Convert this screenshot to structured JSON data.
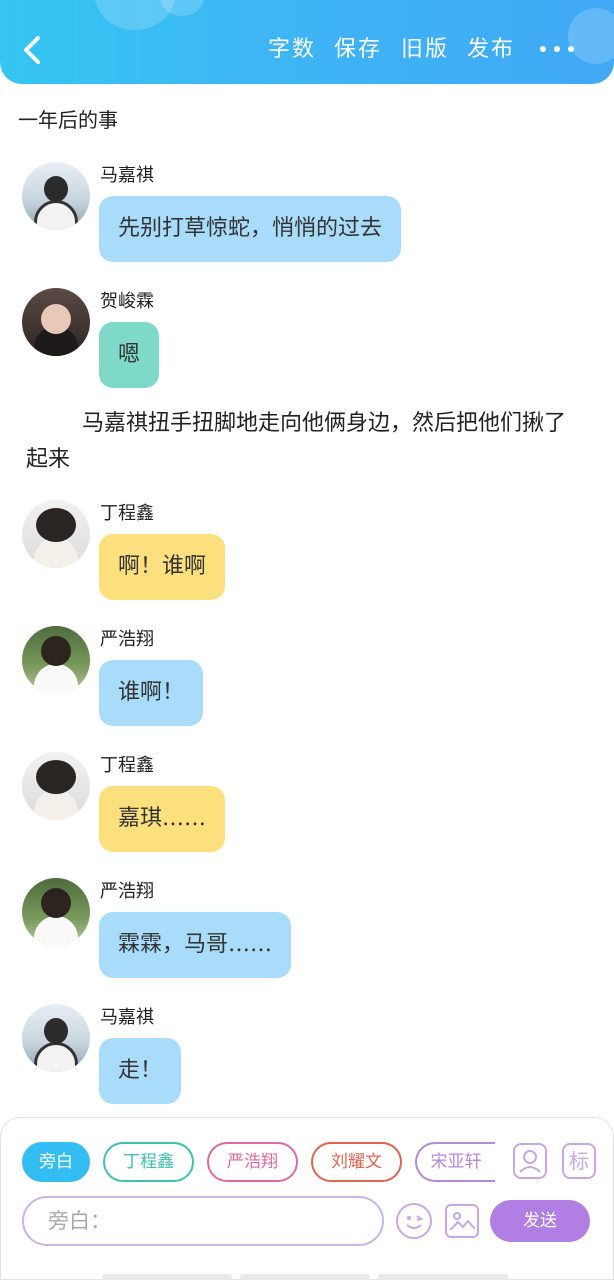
{
  "header": {
    "actions": [
      "字数",
      "保存",
      "旧版",
      "发布"
    ],
    "back_icon": "chevron-left-icon",
    "more_icon": "more-dots-icon"
  },
  "chapter_title": "一年后的事",
  "messages": [
    {
      "name": "马嘉祺",
      "text": "先别打草惊蛇，悄悄的过去",
      "color": "#a9dcfa"
    },
    {
      "name": "贺峻霖",
      "text": "嗯",
      "color": "#7fd9c8"
    },
    {
      "name": "丁程鑫",
      "text": "啊！谁啊",
      "color": "#fde07e"
    },
    {
      "name": "严浩翔",
      "text": "谁啊！",
      "color": "#a9dcfa"
    },
    {
      "name": "丁程鑫",
      "text": "嘉琪……",
      "color": "#fde07e"
    },
    {
      "name": "严浩翔",
      "text": "霖霖，马哥……",
      "color": "#a9dcfa"
    },
    {
      "name": "马嘉祺",
      "text": "走！",
      "color": "#a9dcfa"
    }
  ],
  "narration": "马嘉祺扭手扭脚地走向他俩身边，然后把他们揪了起来",
  "composer": {
    "roles": [
      "旁白",
      "丁程鑫",
      "严浩翔",
      "刘耀文",
      "宋亚轩"
    ],
    "tag_label": "标",
    "input_placeholder": "旁白：",
    "send_label": "发送",
    "icons": [
      "add-character-icon",
      "tag-icon",
      "emoji-icon",
      "image-icon"
    ]
  }
}
